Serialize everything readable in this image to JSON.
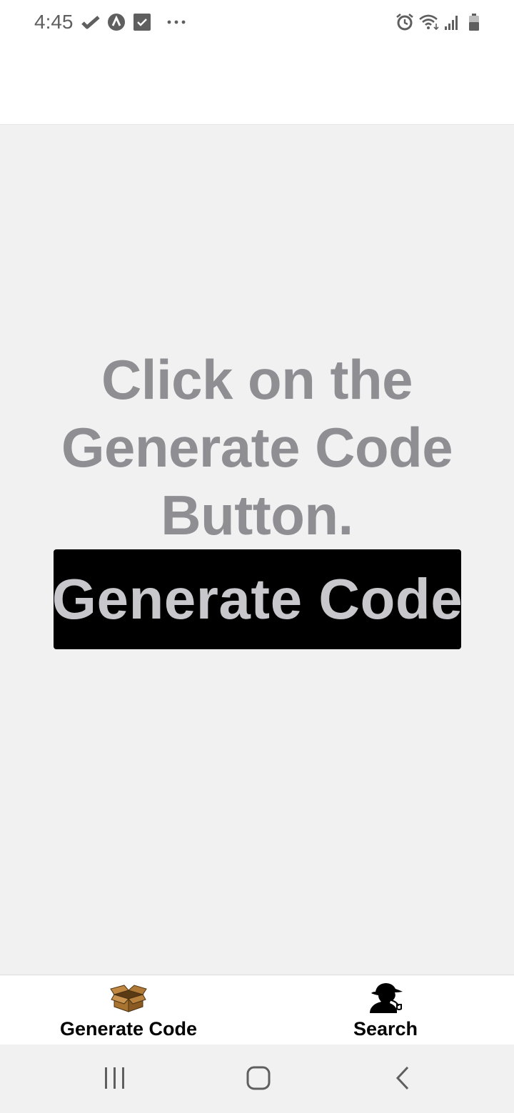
{
  "status_bar": {
    "time": "4:45",
    "left_icons": [
      "check-icon",
      "app-a-icon",
      "checkbox-icon",
      "more-dots-icon"
    ],
    "right_icons": [
      "alarm-icon",
      "wifi-icon",
      "signal-icon",
      "battery-icon"
    ]
  },
  "main": {
    "prompt": "Click on the Generate Code Button.",
    "button_label": "Generate Code"
  },
  "tab_bar": {
    "tabs": [
      {
        "label": "Generate Code",
        "icon": "box-icon"
      },
      {
        "label": "Search",
        "icon": "detective-icon"
      }
    ]
  },
  "nav_bar": {
    "buttons": [
      "recent-apps-icon",
      "home-icon",
      "back-icon"
    ]
  },
  "colors": {
    "background": "#f1f1f1",
    "prompt_text": "#8e8e93",
    "button_bg": "#000000",
    "button_text": "#c7c7cc"
  }
}
